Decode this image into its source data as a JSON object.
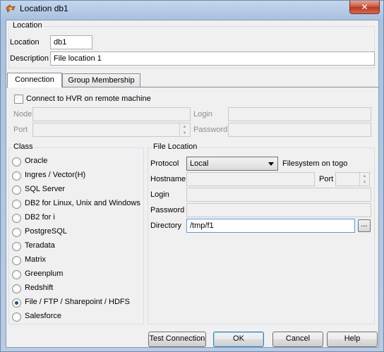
{
  "window": {
    "title": "Location db1",
    "close_label": "✕"
  },
  "location_group": {
    "title": "Location",
    "location_label": "Location",
    "location_value": "db1",
    "description_label": "Description",
    "description_value": "File location 1"
  },
  "tabs": [
    {
      "label": "Connection",
      "active": true
    },
    {
      "label": "Group Membership",
      "active": false
    }
  ],
  "remote": {
    "checkbox_label": "Connect to HVR on remote machine",
    "checked": false,
    "node_label": "Node",
    "node_value": "",
    "port_label": "Port",
    "port_value": "",
    "login_label": "Login",
    "login_value": "",
    "password_label": "Password",
    "password_value": ""
  },
  "class_group": {
    "title": "Class",
    "options": [
      {
        "label": "Oracle",
        "selected": false
      },
      {
        "label": "Ingres / Vector(H)",
        "selected": false
      },
      {
        "label": "SQL Server",
        "selected": false
      },
      {
        "label": "DB2 for Linux, Unix and Windows",
        "selected": false
      },
      {
        "label": "DB2 for i",
        "selected": false
      },
      {
        "label": "PostgreSQL",
        "selected": false
      },
      {
        "label": "Teradata",
        "selected": false
      },
      {
        "label": "Matrix",
        "selected": false
      },
      {
        "label": "Greenplum",
        "selected": false
      },
      {
        "label": "Redshift",
        "selected": false
      },
      {
        "label": "File / FTP / Sharepoint / HDFS",
        "selected": true
      },
      {
        "label": "Salesforce",
        "selected": false
      }
    ]
  },
  "file_location": {
    "title": "File Location",
    "protocol_label": "Protocol",
    "protocol_value": "Local",
    "filesystem_text": "Filesystem on togo",
    "hostname_label": "Hostname",
    "hostname_value": "",
    "port_label": "Port",
    "port_value": "",
    "login_label": "Login",
    "login_value": "",
    "password_label": "Password",
    "password_value": "",
    "directory_label": "Directory",
    "directory_value": "/tmp/f1",
    "browse_label": "..."
  },
  "buttons": {
    "test_connection": "Test Connection",
    "ok": "OK",
    "cancel": "Cancel",
    "help": "Help"
  },
  "colors": {
    "title_gradient_top": "#c4d6ec",
    "close_button": "#c7533a",
    "selected_radio_dot": "#1c4f8c"
  }
}
